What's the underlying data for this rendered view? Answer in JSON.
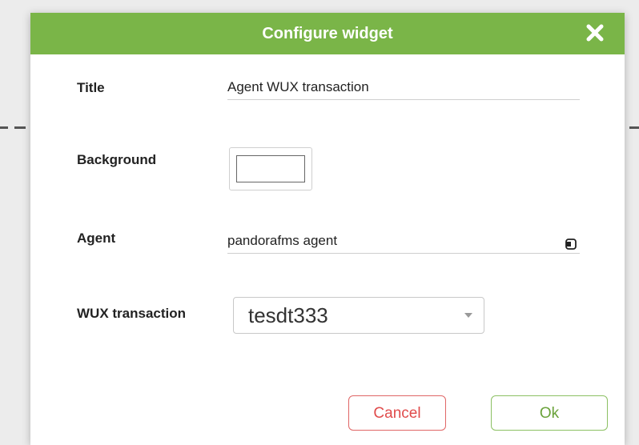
{
  "dialog": {
    "title": "Configure widget",
    "accent_color": "#7ab548",
    "close_icon": "close-icon"
  },
  "fields": {
    "title_label": "Title",
    "title_value": "Agent WUX transaction",
    "background_label": "Background",
    "background_color": "#ffffff",
    "agent_label": "Agent",
    "agent_value": "pandorafms agent",
    "agent_icon": "agent-select-icon",
    "wux_label": "WUX transaction",
    "wux_selected": "tesdt333"
  },
  "buttons": {
    "cancel_label": "Cancel",
    "cancel_color": "#e04b4b",
    "ok_label": "Ok",
    "ok_color": "#6aa23a"
  }
}
